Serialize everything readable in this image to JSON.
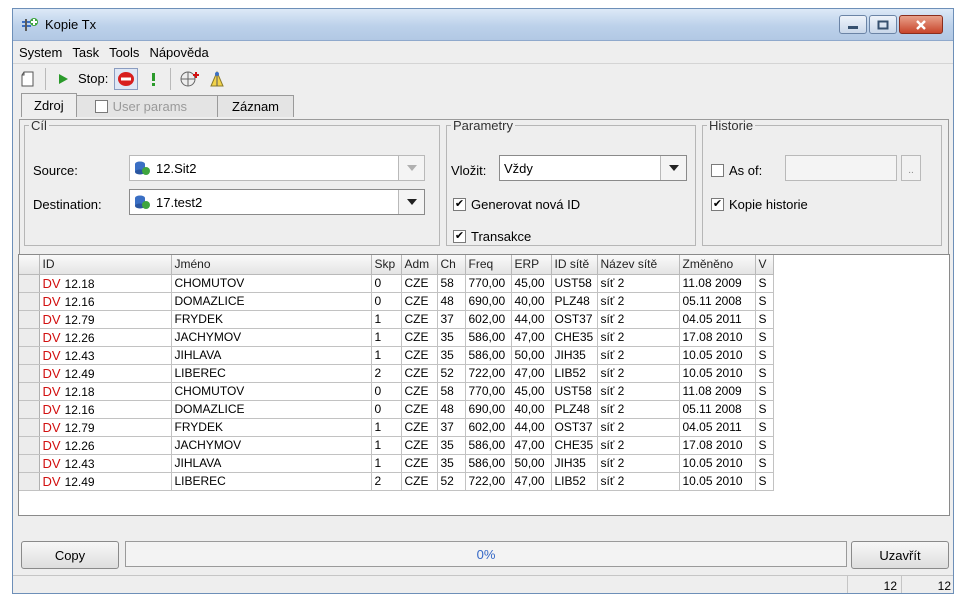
{
  "window": {
    "title": "Kopie Tx"
  },
  "menu": [
    {
      "label": "System"
    },
    {
      "label": "Task"
    },
    {
      "label": "Tools"
    },
    {
      "label": "Nápověda"
    }
  ],
  "toolbar": {
    "stop_label": "Stop:"
  },
  "tabs": [
    {
      "label": "Zdroj",
      "active": true
    },
    {
      "label": "User params",
      "disabled": true
    },
    {
      "label": "Záznam"
    }
  ],
  "cil": {
    "legend": "Cíl",
    "source_label": "Source:",
    "source_value": "12.Sit2",
    "destination_label": "Destination:",
    "destination_value": "17.test2"
  },
  "parametry": {
    "legend": "Parametry",
    "vlozit_label": "Vložit:",
    "vlozit_value": "Vždy",
    "generovat_label": "Generovat nová ID",
    "generovat_checked": true,
    "transakce_label": "Transakce",
    "transakce_checked": true
  },
  "historie": {
    "legend": "Historie",
    "asof_label": "As of:",
    "asof_checked": false,
    "asof_button": "..",
    "kopie_label": "Kopie historie",
    "kopie_checked": true
  },
  "table": {
    "columns": [
      "ID",
      "Jméno",
      "Skp",
      "Adm",
      "Ch",
      "Freq",
      "ERP",
      "ID sítě",
      "Název sítě",
      "Změněno",
      "V"
    ],
    "rows": [
      {
        "prefix": "DV",
        "id": "12.18",
        "jmeno": "CHOMUTOV",
        "skp": "0",
        "adm": "CZE",
        "ch": "58",
        "freq": "770,00",
        "erp": "45,00",
        "idsite": "UST58",
        "nazev": "síť 2",
        "zmeneno": "11.08 2009",
        "v": "S"
      },
      {
        "prefix": "DV",
        "id": "12.16",
        "jmeno": "DOMAZLICE",
        "skp": "0",
        "adm": "CZE",
        "ch": "48",
        "freq": "690,00",
        "erp": "40,00",
        "idsite": "PLZ48",
        "nazev": "síť 2",
        "zmeneno": "05.11 2008",
        "v": "S"
      },
      {
        "prefix": "DV",
        "id": "12.79",
        "jmeno": "FRYDEK",
        "skp": "1",
        "adm": "CZE",
        "ch": "37",
        "freq": "602,00",
        "erp": "44,00",
        "idsite": "OST37",
        "nazev": "síť 2",
        "zmeneno": "04.05 2011",
        "v": "S"
      },
      {
        "prefix": "DV",
        "id": "12.26",
        "jmeno": "JACHYMOV",
        "skp": "1",
        "adm": "CZE",
        "ch": "35",
        "freq": "586,00",
        "erp": "47,00",
        "idsite": "CHE35",
        "nazev": "síť 2",
        "zmeneno": "17.08 2010",
        "v": "S"
      },
      {
        "prefix": "DV",
        "id": "12.43",
        "jmeno": "JIHLAVA",
        "skp": "1",
        "adm": "CZE",
        "ch": "35",
        "freq": "586,00",
        "erp": "50,00",
        "idsite": "JIH35",
        "nazev": "síť 2",
        "zmeneno": "10.05 2010",
        "v": "S"
      },
      {
        "prefix": "DV",
        "id": "12.49",
        "jmeno": "LIBEREC",
        "skp": "2",
        "adm": "CZE",
        "ch": "52",
        "freq": "722,00",
        "erp": "47,00",
        "idsite": "LIB52",
        "nazev": "síť 2",
        "zmeneno": "10.05 2010",
        "v": "S"
      },
      {
        "prefix": "DV",
        "id": "12.18",
        "jmeno": "CHOMUTOV",
        "skp": "0",
        "adm": "CZE",
        "ch": "58",
        "freq": "770,00",
        "erp": "45,00",
        "idsite": "UST58",
        "nazev": "síť 2",
        "zmeneno": "11.08 2009",
        "v": "S"
      },
      {
        "prefix": "DV",
        "id": "12.16",
        "jmeno": "DOMAZLICE",
        "skp": "0",
        "adm": "CZE",
        "ch": "48",
        "freq": "690,00",
        "erp": "40,00",
        "idsite": "PLZ48",
        "nazev": "síť 2",
        "zmeneno": "05.11 2008",
        "v": "S"
      },
      {
        "prefix": "DV",
        "id": "12.79",
        "jmeno": "FRYDEK",
        "skp": "1",
        "adm": "CZE",
        "ch": "37",
        "freq": "602,00",
        "erp": "44,00",
        "idsite": "OST37",
        "nazev": "síť 2",
        "zmeneno": "04.05 2011",
        "v": "S"
      },
      {
        "prefix": "DV",
        "id": "12.26",
        "jmeno": "JACHYMOV",
        "skp": "1",
        "adm": "CZE",
        "ch": "35",
        "freq": "586,00",
        "erp": "47,00",
        "idsite": "CHE35",
        "nazev": "síť 2",
        "zmeneno": "17.08 2010",
        "v": "S"
      },
      {
        "prefix": "DV",
        "id": "12.43",
        "jmeno": "JIHLAVA",
        "skp": "1",
        "adm": "CZE",
        "ch": "35",
        "freq": "586,00",
        "erp": "50,00",
        "idsite": "JIH35",
        "nazev": "síť 2",
        "zmeneno": "10.05 2010",
        "v": "S"
      },
      {
        "prefix": "DV",
        "id": "12.49",
        "jmeno": "LIBEREC",
        "skp": "2",
        "adm": "CZE",
        "ch": "52",
        "freq": "722,00",
        "erp": "47,00",
        "idsite": "LIB52",
        "nazev": "síť 2",
        "zmeneno": "10.05 2010",
        "v": "S"
      }
    ]
  },
  "actions": {
    "copy_label": "Copy",
    "close_label": "Uzavřít",
    "progress_text": "0%",
    "progress_fraction": 0
  },
  "status": {
    "cell1": "12",
    "cell2": "12"
  },
  "colors": {
    "id_prefix": "#d21010",
    "progress_text": "#3568c6",
    "close_button": "#c8452b"
  }
}
